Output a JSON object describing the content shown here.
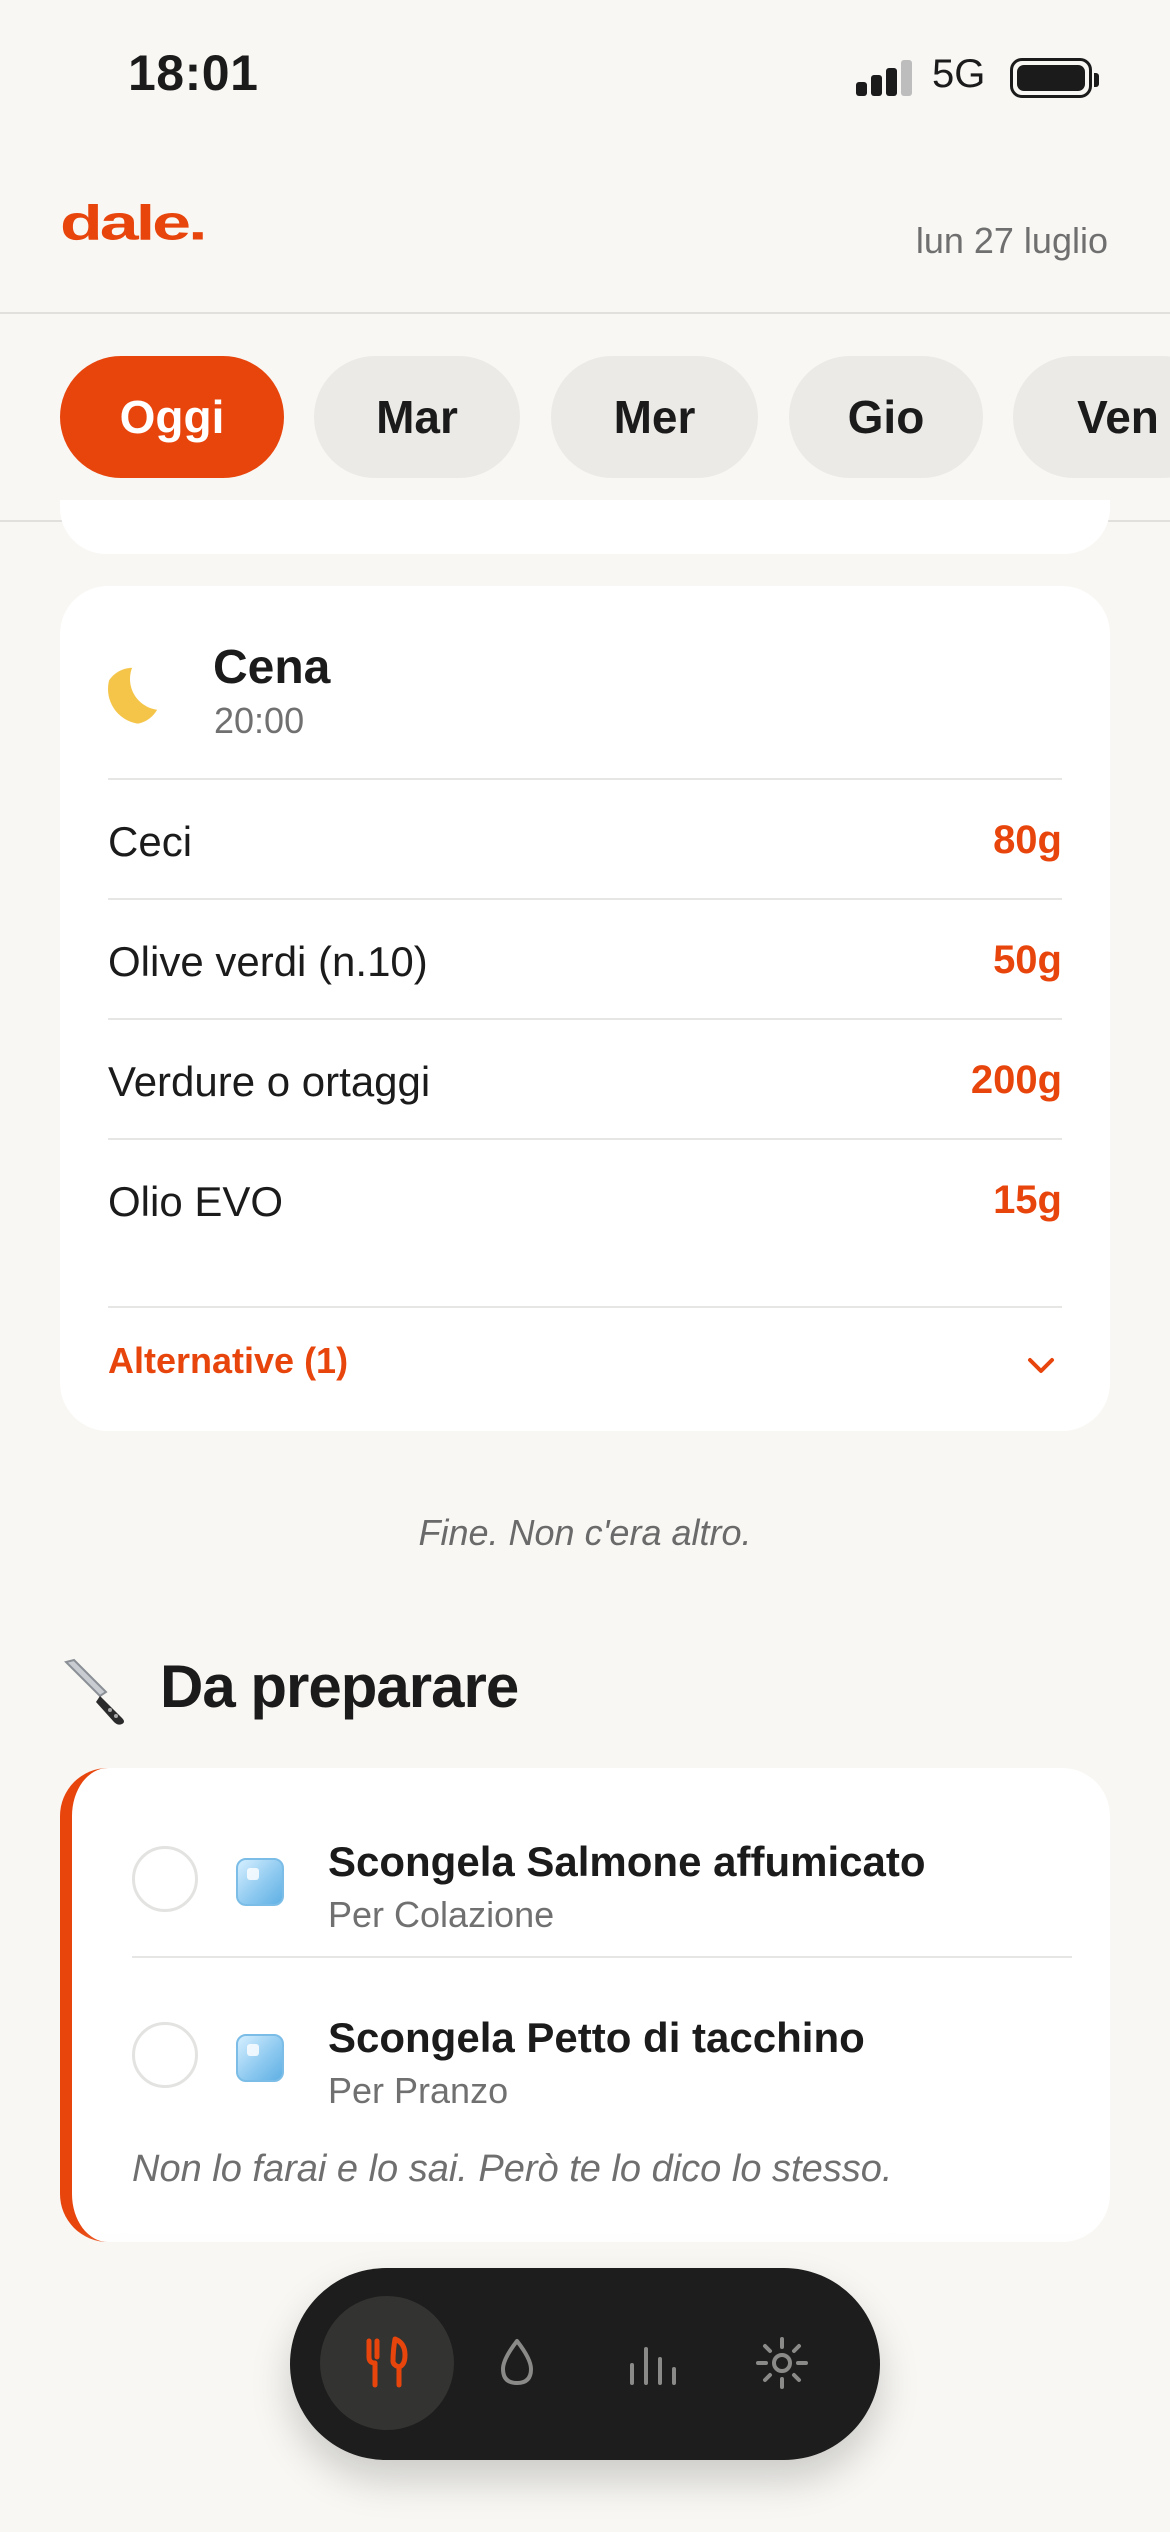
{
  "status_bar": {
    "time": "18:01",
    "network": "5G"
  },
  "header": {
    "logo": "dale.",
    "date": "lun 27 luglio"
  },
  "day_tabs": [
    {
      "label": "Oggi",
      "active": true
    },
    {
      "label": "Mar",
      "active": false
    },
    {
      "label": "Mer",
      "active": false
    },
    {
      "label": "Gio",
      "active": false
    },
    {
      "label": "Ven",
      "active": false
    }
  ],
  "meal": {
    "icon": "moon-icon",
    "title": "Cena",
    "time": "20:00",
    "items": [
      {
        "name": "Ceci",
        "qty": "80g"
      },
      {
        "name": "Olive verdi (n.10)",
        "qty": "50g"
      },
      {
        "name": "Verdure o ortaggi",
        "qty": "200g"
      },
      {
        "name": "Olio EVO",
        "qty": "15g"
      }
    ],
    "alternatives_label": "Alternative (1)"
  },
  "end_note": "Fine. Non c'era altro.",
  "prep": {
    "title": "Da preparare",
    "tasks": [
      {
        "title": "Scongela Salmone affumicato",
        "subtitle": "Per Colazione"
      },
      {
        "title": "Scongela Petto di tacchino",
        "subtitle": "Per Pranzo"
      }
    ],
    "note": "Non lo farai e lo sai. Però te lo dico lo stesso."
  },
  "bottom_nav": [
    {
      "icon": "fork-knife-icon",
      "active": true
    },
    {
      "icon": "water-drop-icon",
      "active": false
    },
    {
      "icon": "bar-chart-icon",
      "active": false
    },
    {
      "icon": "sun-icon",
      "active": false
    }
  ],
  "colors": {
    "accent": "#e8450d",
    "background": "#f8f7f3",
    "nav": "#1d1d1d"
  }
}
